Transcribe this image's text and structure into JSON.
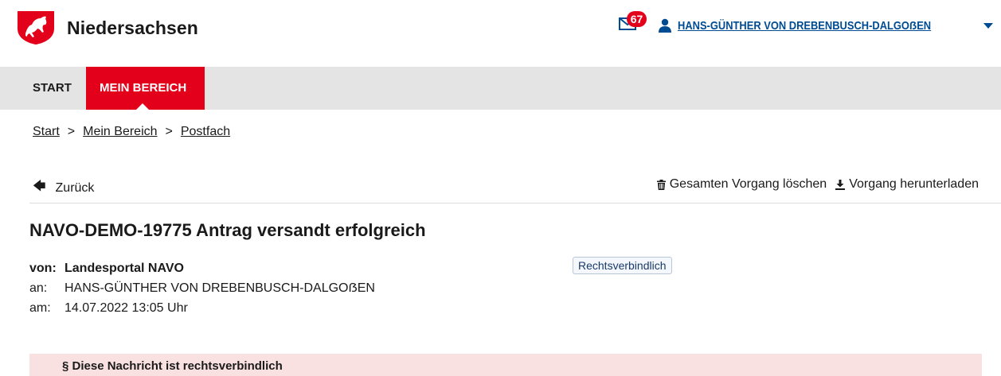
{
  "header": {
    "brand": "Niedersachsen",
    "mail_count": "67",
    "user_name": "HANS-GÜNTHER VON DREBENBUSCH-DALGOẞEN",
    "colors": {
      "accent_red": "#e2001a",
      "link_blue": "#004c93"
    }
  },
  "nav": {
    "items": [
      {
        "label": "START"
      },
      {
        "label": "MEIN BEREICH"
      }
    ]
  },
  "breadcrumb": {
    "items": [
      "Start",
      "Mein Bereich",
      "Postfach"
    ],
    "separator": ">"
  },
  "actions": {
    "back": "Zurück",
    "delete": "Gesamten Vorgang löschen",
    "download": "Vorgang herunterladen"
  },
  "message": {
    "title": "NAVO-DEMO-19775 Antrag versandt erfolgreich",
    "from_key": "von:",
    "from_value": "Landesportal NAVO",
    "to_key": "an:",
    "to_value": "HANS-GÜNTHER VON DREBENBUSCH-DALGOẞEN",
    "date_key": "am:",
    "date_value": "14.07.2022 13:05 Uhr",
    "tag": "Rechtsverbindlich",
    "legal_notice": "§ Diese Nachricht ist rechtsverbindlich"
  }
}
